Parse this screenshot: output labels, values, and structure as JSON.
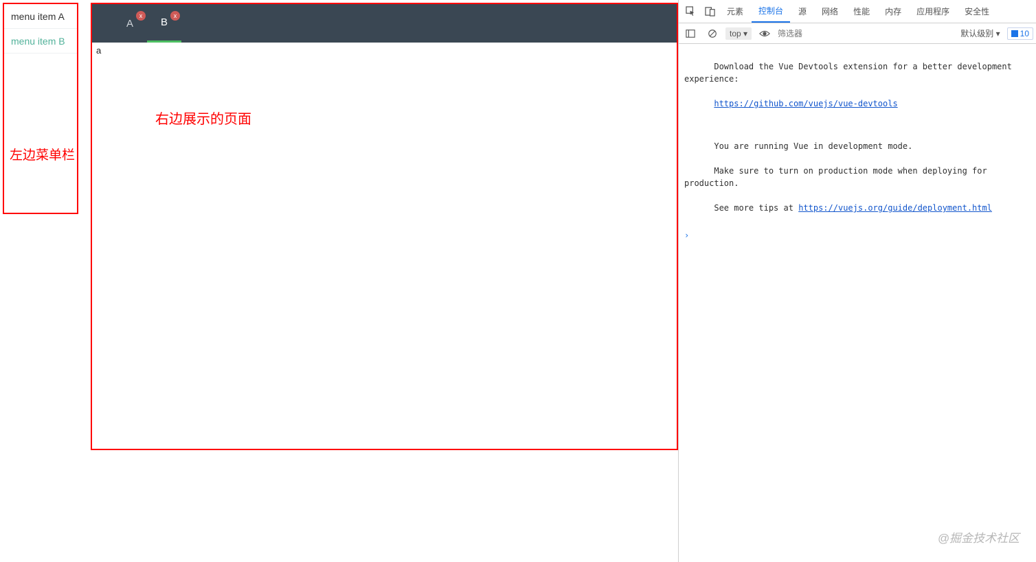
{
  "sidebar": {
    "items": [
      {
        "label": "menu item A"
      },
      {
        "label": "menu item B"
      }
    ],
    "annotation": "左边菜单栏"
  },
  "main": {
    "tabs": [
      {
        "label": "A",
        "close": "x"
      },
      {
        "label": "B",
        "close": "x"
      }
    ],
    "content_value": "a",
    "annotation": "右边展示的页面"
  },
  "devtools": {
    "tabs": [
      "元素",
      "控制台",
      "源",
      "网络",
      "性能",
      "内存",
      "应用程序",
      "安全性"
    ],
    "active_tab_index": 1,
    "toolbar": {
      "context": "top ▾",
      "filter_placeholder": "筛选器",
      "level": "默认级别 ▾",
      "issues_count": "10"
    },
    "console": {
      "line1": "Download the Vue Devtools extension for a better development experience:",
      "link1": "https://github.com/vuejs/vue-devtools",
      "line2": "You are running Vue in development mode.",
      "line3": "Make sure to turn on production mode when deploying for production.",
      "line4_pre": "See more tips at ",
      "link2": "https://vuejs.org/guide/deployment.html",
      "prompt": "›"
    }
  },
  "watermark": "@掘金技术社区"
}
